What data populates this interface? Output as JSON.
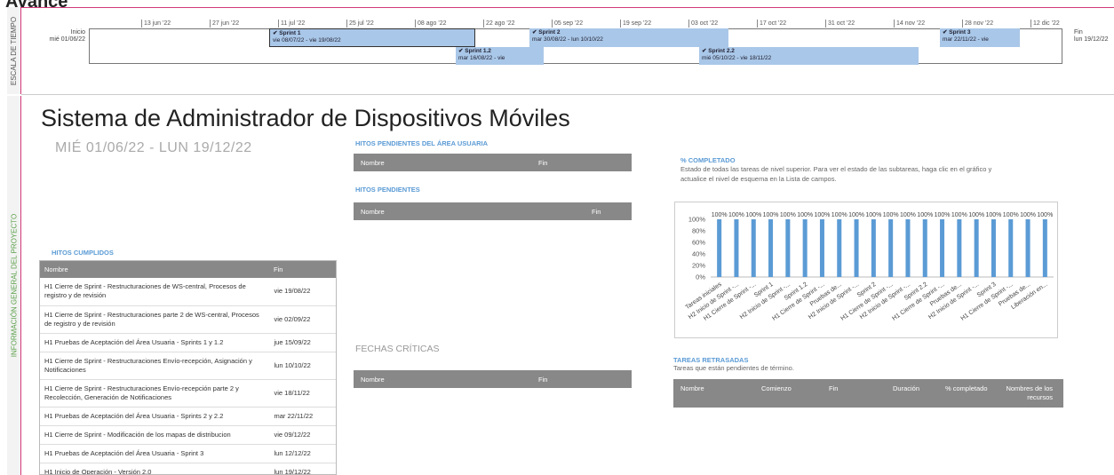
{
  "page_title": "Avance",
  "strips": {
    "timescale_label": "ESCALA DE TIEMPO",
    "overview_label": "INFORMACIÓN GENERAL DEL PROYECTO"
  },
  "timeline": {
    "start_label": "Inicio",
    "start_date": "mié 01/06/22",
    "end_label": "Fin",
    "end_date": "lun 19/12/22",
    "ticks": [
      "13 jun '22",
      "27 jun '22",
      "11 jul '22",
      "25 jul '22",
      "08 ago '22",
      "22 ago '22",
      "05 sep '22",
      "19 sep '22",
      "03 oct '22",
      "17 oct '22",
      "31 oct '22",
      "14 nov '22",
      "28 nov '22",
      "12 dic '22"
    ],
    "bars": [
      {
        "name": "Sprint 1",
        "dates": "vie 08/07/22 - vie 19/08/22"
      },
      {
        "name": "Sprint 2",
        "dates": "mar 30/08/22 - lun 10/10/22"
      },
      {
        "name": "Sprint 3",
        "dates": "mar 22/11/22 - vie"
      },
      {
        "name": "Sprint 1.2",
        "dates": "mar 16/08/22 - vie"
      },
      {
        "name": "Sprint 2.2",
        "dates": "mié 05/10/22 - vie 18/11/22"
      }
    ]
  },
  "project": {
    "name": "Sistema de Administrador de Dispositivos Móviles",
    "dates": "MIÉ 01/06/22  -  LUN 19/12/22"
  },
  "hitos_cumplidos": {
    "title": "HITOS CUMPLIDOS",
    "columns": [
      "Nombre",
      "Fin"
    ],
    "rows": [
      {
        "nombre": "H1 Cierre de Sprint - Restructuraciones de WS-central, Procesos de registro y de revisión",
        "fin": "vie 19/08/22"
      },
      {
        "nombre": "H1 Cierre de Sprint - Restructuraciones parte 2 de WS-central, Procesos de registro y de revisión",
        "fin": "vie 02/09/22"
      },
      {
        "nombre": "H1 Pruebas de Aceptación del Área Usuaria - Sprints 1 y 1.2",
        "fin": "jue 15/09/22"
      },
      {
        "nombre": "H1 Cierre de Sprint - Restructuraciones Envío-recepción, Asignación y Notificaciones",
        "fin": "lun 10/10/22"
      },
      {
        "nombre": "H1 Cierre de Sprint - Restructuraciones Envío-recepción parte 2 y Recolección, Generación de Notificaciones",
        "fin": "vie 18/11/22"
      },
      {
        "nombre": "H1 Pruebas de Aceptación del Área Usuaria - Sprints 2 y 2.2",
        "fin": "mar 22/11/22"
      },
      {
        "nombre": "H1 Cierre de Sprint - Modificación de los mapas de distribucion",
        "fin": "vie 09/12/22"
      },
      {
        "nombre": "H1 Pruebas de Aceptación del Área Usuaria - Sprint 3",
        "fin": "lun 12/12/22"
      },
      {
        "nombre": "H1 Inicio de Operación - Versión 2.0",
        "fin": "lun 19/12/22"
      }
    ]
  },
  "hitos_pendientes_area": {
    "title": "HITOS PENDIENTES DEL ÁREA USUARIA",
    "columns": [
      "Nombre",
      "Fin"
    ]
  },
  "hitos_pendientes": {
    "title": "HITOS PENDIENTES",
    "columns": [
      "Nombre",
      "Fin"
    ]
  },
  "fechas_criticas": {
    "title": "FECHAS CRÍTICAS",
    "columns": [
      "Nombre",
      "Fin"
    ]
  },
  "pct_completado": {
    "title": "% COMPLETADO",
    "description": "Estado de todas las tareas de nivel superior. Para ver el estado de las subtareas, haga clic en el gráfico y actualice el nivel de esquema en la Lista de campos."
  },
  "tareas_retrasadas": {
    "title": "TAREAS RETRASADAS",
    "description": "Tareas que están pendientes de término.",
    "columns": [
      "Nombre",
      "Comienzo",
      "Fin",
      "Duración",
      "% completado",
      "Nombres de los recursos"
    ]
  },
  "chart_data": {
    "type": "bar",
    "categories": [
      "Tareas iniciales",
      "H2 Inicio de Sprint -...",
      "H1 Cierre de Sprint -...",
      "Sprint 1",
      "H2 Inicio de Sprint -...",
      "Sprint 1.2",
      "H1 Cierre de Sprint -...",
      "Pruebas de...",
      "H2 Inicio de Sprint -...",
      "Sprint 2",
      "H1 Cierre de Sprint -...",
      "H2 Inicio de Sprint -...",
      "Sprint 2.2",
      "H1 Cierre de Sprint -...",
      "Pruebas de...",
      "H2 Inicio de Sprint -...",
      "Sprint 3",
      "H1 Cierre de Sprint -...",
      "Pruebas de...",
      "Liberación en..."
    ],
    "values": [
      100,
      100,
      100,
      100,
      100,
      100,
      100,
      100,
      100,
      100,
      100,
      100,
      100,
      100,
      100,
      100,
      100,
      100,
      100,
      100
    ],
    "data_labels": [
      "100%",
      "100%",
      "100%",
      "100%",
      "100%",
      "100%",
      "100%",
      "100%",
      "100%",
      "100%",
      "100%",
      "100%",
      "100%",
      "100%",
      "100%",
      "100%",
      "100%",
      "100%",
      "100%",
      "100%"
    ],
    "ytick_labels": [
      "100%",
      "80%",
      "60%",
      "40%",
      "20%",
      "0%"
    ],
    "ylim": [
      0,
      100
    ],
    "grid": false,
    "bar_color": "#5b9bd5"
  }
}
